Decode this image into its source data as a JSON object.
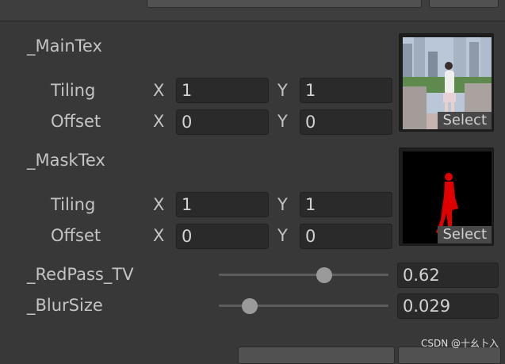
{
  "properties": {
    "main_tex": {
      "label": "_MainTex",
      "tiling": {
        "label": "Tiling",
        "x_axis": "X",
        "x": "1",
        "y_axis": "Y",
        "y": "1"
      },
      "offset": {
        "label": "Offset",
        "x_axis": "X",
        "x": "0",
        "y_axis": "Y",
        "y": "0"
      },
      "select_label": "Select"
    },
    "mask_tex": {
      "label": "_MaskTex",
      "tiling": {
        "label": "Tiling",
        "x_axis": "X",
        "x": "1",
        "y_axis": "Y",
        "y": "1"
      },
      "offset": {
        "label": "Offset",
        "x_axis": "X",
        "x": "0",
        "y_axis": "Y",
        "y": "0"
      },
      "select_label": "Select"
    },
    "red_pass_tv": {
      "label": "_RedPass_TV",
      "value": "0.62",
      "fraction": 0.62
    },
    "blur_size": {
      "label": "_BlurSize",
      "value": "0.029",
      "fraction": 0.18
    }
  },
  "watermark": "CSDN @十幺卜入",
  "colors": {
    "background": "#383838",
    "field": "#2a2a2a",
    "mask_red": "#e00000"
  }
}
